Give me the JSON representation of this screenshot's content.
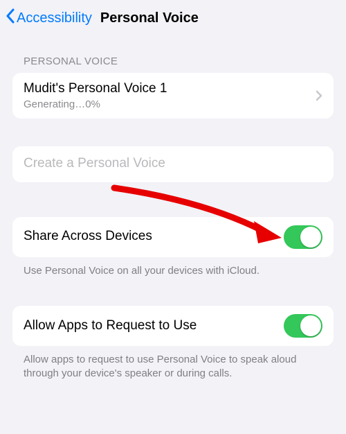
{
  "nav": {
    "back_label": "Accessibility",
    "title": "Personal Voice"
  },
  "section_header": "PERSONAL VOICE",
  "voice_row": {
    "title": "Mudit's Personal Voice 1",
    "status": "Generating…0%"
  },
  "create_row": {
    "title": "Create a Personal Voice"
  },
  "share_row": {
    "title": "Share Across Devices",
    "toggle_on": true,
    "footer": "Use Personal Voice on all your devices with iCloud."
  },
  "allow_row": {
    "title": "Allow Apps to Request to Use",
    "toggle_on": true,
    "footer": "Allow apps to request to use Personal Voice to speak aloud through your device's speaker or during calls."
  },
  "colors": {
    "ios_blue": "#007aff",
    "ios_green": "#34c759",
    "arrow_red": "#e60000"
  }
}
